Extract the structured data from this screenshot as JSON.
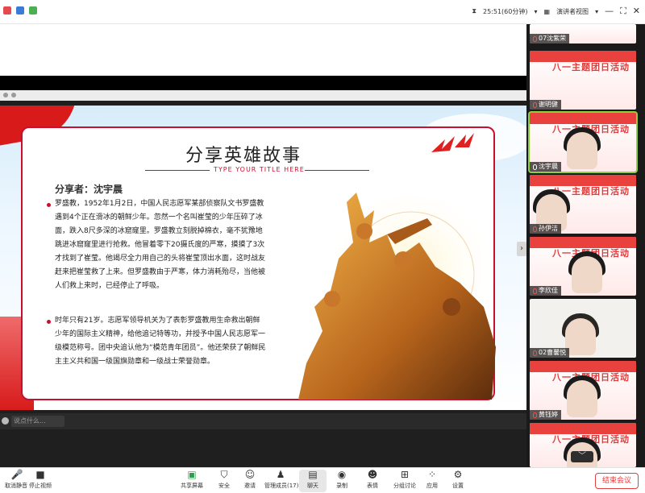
{
  "topbar": {
    "timer": "25:51(60分钟)",
    "view_label": "演讲者视图",
    "controls": [
      "minimize",
      "fullscreen",
      "close"
    ]
  },
  "slide": {
    "title": "分享英雄故事",
    "subtitle": "TYPE YOUR TITLE HERE",
    "presenter": "分享者：沈宇晨",
    "paragraphs": [
      "罗盛教，1952年1月2日，中国人民志愿军某部侦察队文书罗盛教遇到4个正在滑冰的朝鲜少年。忽然一个名叫崔莹的少年压碎了冰面，跌入8尺多深的冰窟窿里。罗盛教立刻脱掉棉衣，毫不犹豫地跳进冰窟窿里进行抢救。他冒着零下20摄氏度的严寒，摸摸了3次才找到了崔莹。他竭尽全力用自己的头将崔莹顶出水面，这时战友赶来把崔莹救了上来。但罗盛教由于严寒，体力消耗殆尽，当他被人们救上来时，已经停止了呼吸。",
      "时年只有21岁。志愿军领导机关为了表彰罗盛教用生命救出朝鲜少年的国际主义精神，给他追记特等功，并授予中国人民志愿军一级模范称号。团中央追认他为“模范青年团员”。他还荣获了朝鲜民主主义共和国一级国旗勋章和一级战士荣誉勋章。"
    ]
  },
  "chat": {
    "placeholder": "说点什么..."
  },
  "gallery": {
    "banner": "八一主题团日活动",
    "tiles": [
      {
        "name": "07沈紫荣",
        "active": false
      },
      {
        "name": "谢明健",
        "active": false
      },
      {
        "name": "沈宇晨",
        "active": true
      },
      {
        "name": "孙伊洁",
        "active": false
      },
      {
        "name": "李欣佳",
        "active": false
      },
      {
        "name": "02曹馨悦",
        "active": false
      },
      {
        "name": "黄钰婷",
        "active": false
      },
      {
        "name": "",
        "active": false
      }
    ],
    "toggle": "›"
  },
  "toolbar": {
    "items": [
      {
        "icon": "mic-icon",
        "label": "取消静音"
      },
      {
        "icon": "camera-icon",
        "label": "停止视频"
      },
      {
        "icon": "share-screen-icon",
        "label": "共享屏幕"
      },
      {
        "icon": "security-icon",
        "label": "安全"
      },
      {
        "icon": "invite-icon",
        "label": "邀请"
      },
      {
        "icon": "participants-icon",
        "label": "管理成员(17)"
      },
      {
        "icon": "chat-icon",
        "label": "聊天"
      },
      {
        "icon": "record-icon",
        "label": "录制"
      },
      {
        "icon": "reaction-icon",
        "label": "表情"
      },
      {
        "icon": "breakout-icon",
        "label": "分组讨论"
      },
      {
        "icon": "apps-icon",
        "label": "应用"
      },
      {
        "icon": "settings-icon",
        "label": "设置"
      }
    ],
    "end_label": "结束会议"
  },
  "colors": {
    "accent_red": "#c8102e",
    "end_red": "#e34040",
    "active_green": "#8bd13f"
  }
}
